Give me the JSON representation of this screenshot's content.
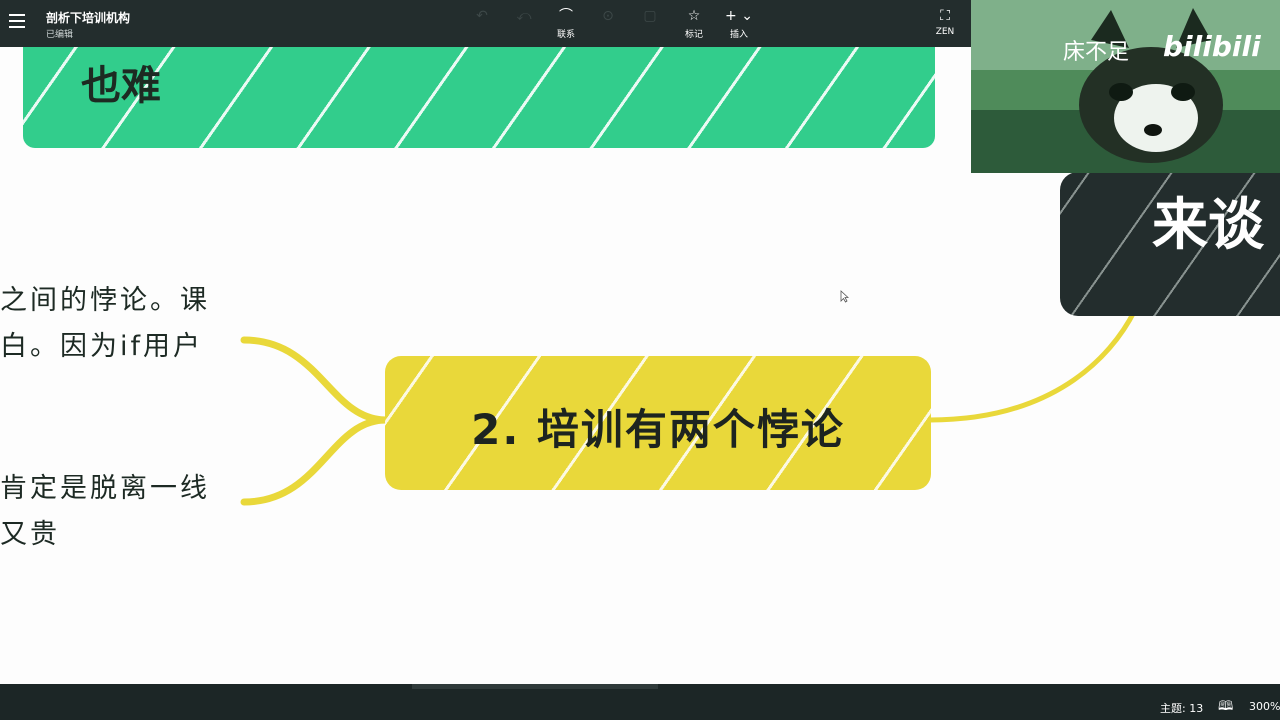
{
  "topbar": {
    "title": "剖析下培训机构",
    "subtitle": "已编辑",
    "tools": [
      {
        "icon": "undo-icon",
        "glyph": "↶",
        "label": "",
        "enabled": false
      },
      {
        "icon": "redo-icon",
        "glyph": "⤺",
        "label": "",
        "enabled": false
      },
      {
        "icon": "relation-icon",
        "glyph": "⌒",
        "label": "联系",
        "enabled": true
      },
      {
        "icon": "summary-icon",
        "glyph": "⊙",
        "label": "",
        "enabled": false
      },
      {
        "icon": "boundary-icon",
        "glyph": "▢",
        "label": "",
        "enabled": false
      },
      {
        "icon": "star-icon",
        "glyph": "☆",
        "label": "标记",
        "enabled": true
      },
      {
        "icon": "plus-icon",
        "glyph": "+ ⌄",
        "label": "插入",
        "enabled": true
      },
      {
        "icon": "fullscreen-icon",
        "glyph": "⛶",
        "label": "ZEN",
        "enabled": true
      }
    ]
  },
  "canvas": {
    "green_topic": "也难",
    "main_topic": "2. 培训有两个悖论",
    "left_branch_1": [
      "之间的悖论。课",
      "白。因为if用户"
    ],
    "left_branch_2": [
      "肯定是脱离一线",
      "又贵"
    ],
    "right_topic": "来谈"
  },
  "webcam": {
    "overlay_text": "床不足",
    "logo": "bilibili"
  },
  "statusbar": {
    "topics": "主题: 13",
    "zoom": "300%"
  },
  "colors": {
    "toolbar": "#232d2d",
    "green_topic": "#32cd8c",
    "main_topic": "#e9d83a",
    "connector": "#e9d83a"
  }
}
